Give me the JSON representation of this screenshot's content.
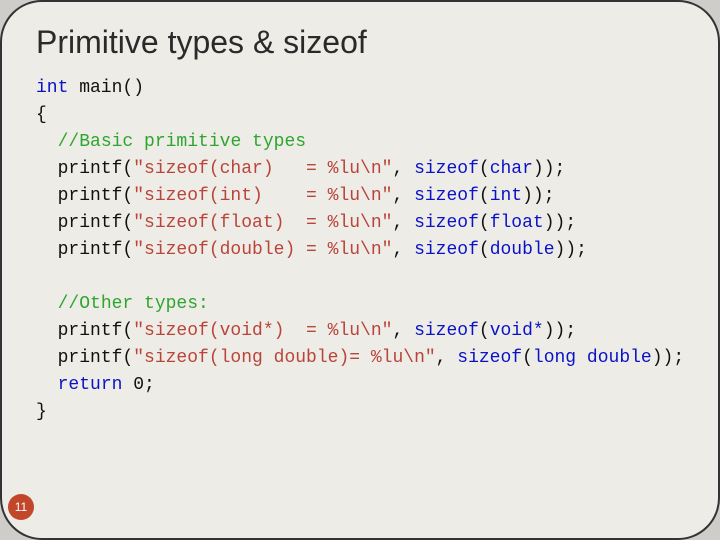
{
  "title": "Primitive types & sizeof",
  "page_number": "11",
  "code": {
    "l01_int": "int",
    "l01_rest": " main()",
    "l02": "{",
    "l03_indent": "  ",
    "l03_cm": "//Basic primitive types",
    "l04_indent": "  printf(",
    "l04_str": "\"sizeof(char)   = %lu\\n\"",
    "l04_mid": ", ",
    "l04_sz": "sizeof",
    "l04_p1": "(",
    "l04_ty": "char",
    "l04_p2": "));",
    "l05_indent": "  printf(",
    "l05_str": "\"sizeof(int)    = %lu\\n\"",
    "l05_mid": ", ",
    "l05_sz": "sizeof",
    "l05_p1": "(",
    "l05_ty": "int",
    "l05_p2": "));",
    "l06_indent": "  printf(",
    "l06_str": "\"sizeof(float)  = %lu\\n\"",
    "l06_mid": ", ",
    "l06_sz": "sizeof",
    "l06_p1": "(",
    "l06_ty": "float",
    "l06_p2": "));",
    "l07_indent": "  printf(",
    "l07_str": "\"sizeof(double) = %lu\\n\"",
    "l07_mid": ", ",
    "l07_sz": "sizeof",
    "l07_p1": "(",
    "l07_ty": "double",
    "l07_p2": "));",
    "blank": "",
    "l09_indent": "  ",
    "l09_cm": "//Other types:",
    "l10_indent": "  printf(",
    "l10_str": "\"sizeof(void*)  = %lu\\n\"",
    "l10_mid": ", ",
    "l10_sz": "sizeof",
    "l10_p1": "(",
    "l10_ty": "void",
    "l10_star": "*",
    "l10_p2": "));",
    "l11_indent": "  printf(",
    "l11_str": "\"sizeof(long double)= %lu\\n\"",
    "l11_mid": ", ",
    "l11_sz": "sizeof",
    "l11_p1": "(",
    "l11_ty": "long double",
    "l11_p2": "));",
    "l12_indent": "  ",
    "l12_ret": "return",
    "l12_sp": " ",
    "l12_num": "0",
    "l12_semi": ";",
    "l13": "}"
  }
}
